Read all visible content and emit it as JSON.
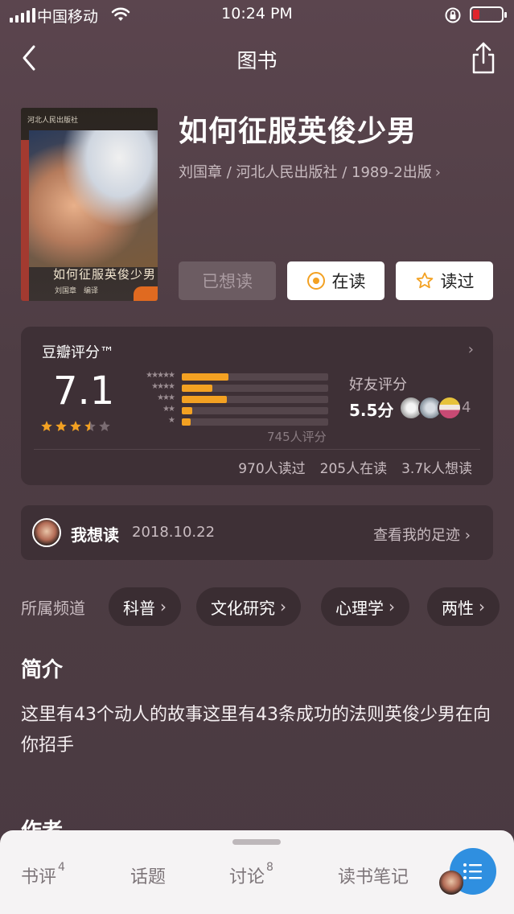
{
  "status_bar": {
    "carrier": "中国移动",
    "time": "10:24 PM"
  },
  "nav": {
    "title": "图书"
  },
  "book": {
    "cover_publisher": "河北人民出版社",
    "cover_title": "如何征服英俊少男",
    "cover_author": "刘国章　编译",
    "title": "如何征服英俊少男",
    "meta": "刘国章 / 河北人民出版社 / 1989-2出版"
  },
  "actions": {
    "want": "已想读",
    "reading": "在读",
    "read": "读过"
  },
  "rating": {
    "label": "豆瓣评分™",
    "score": "7.1",
    "stars": 3.5,
    "distribution": [
      {
        "stars": "★★★★★",
        "fraction": 0.32
      },
      {
        "stars": "★★★★",
        "fraction": 0.21
      },
      {
        "stars": "★★★",
        "fraction": 0.31
      },
      {
        "stars": "★★",
        "fraction": 0.07
      },
      {
        "stars": "★",
        "fraction": 0.06
      }
    ],
    "count": "745人评分",
    "friend_label": "好友评分",
    "friend_score": "5.5分",
    "friend_count": "4",
    "stats": [
      "970人读过",
      "205人在读",
      "3.7k人想读"
    ]
  },
  "want_row": {
    "label": "我想读",
    "date": "2018.10.22",
    "link": "查看我的足迹"
  },
  "channels": {
    "label": "所属频道",
    "items": [
      "科普",
      "文化研究",
      "心理学",
      "两性"
    ]
  },
  "intro": {
    "title": "简介",
    "text": "这里有43个动人的故事这里有43条成功的法则英俊少男在向你招手"
  },
  "author_section": {
    "title": "作者"
  },
  "bottom_tabs": [
    {
      "label": "书评",
      "count": "4"
    },
    {
      "label": "话题",
      "count": ""
    },
    {
      "label": "讨论",
      "count": "8"
    },
    {
      "label": "读书笔记",
      "count": ""
    }
  ],
  "colors": {
    "accent": "#f3a122",
    "fab": "#2f8fe0",
    "background": "#4a3a40"
  }
}
